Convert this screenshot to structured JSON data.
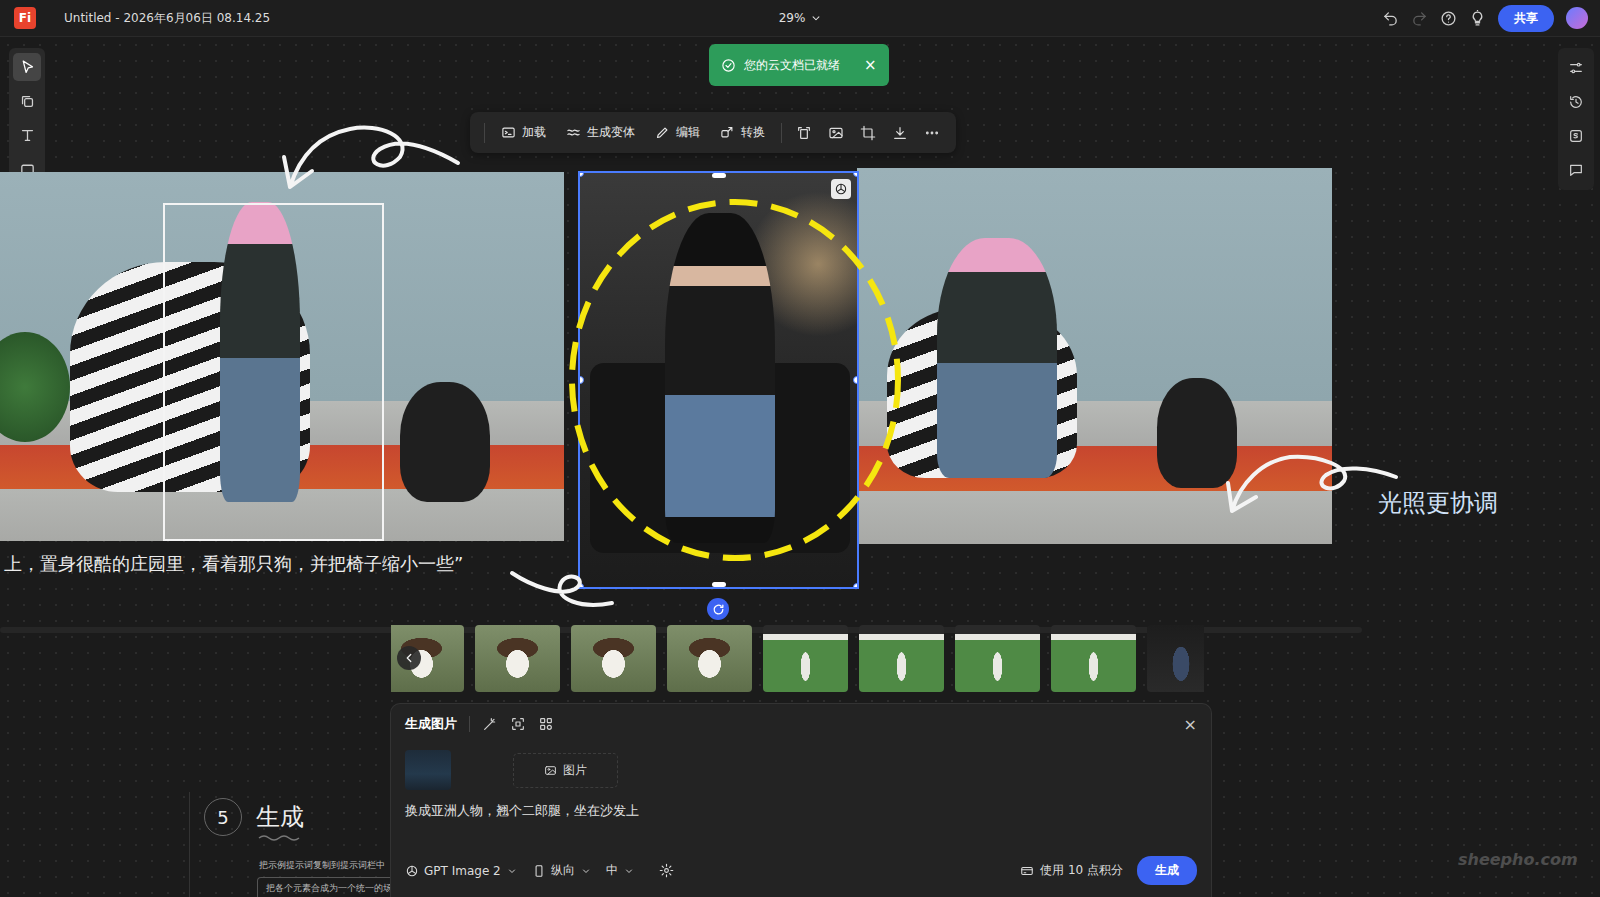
{
  "app": {
    "logo": "Fi",
    "title": "Untitled - 2026年6月06日 08.14.25",
    "zoom": "29%",
    "share": "共享"
  },
  "toast": {
    "text": "您的云文档已就绪",
    "close": "×"
  },
  "left_toolbar": {
    "tools": [
      {
        "selected": true
      },
      {
        "selected": false
      },
      {
        "selected": false
      },
      {
        "selected": false
      },
      {
        "selected": false
      },
      {
        "selected": false
      }
    ]
  },
  "context_toolbar": {
    "actions": [
      "加载",
      "生成变体",
      "编辑",
      "转换"
    ]
  },
  "canvas": {
    "caption": "上，置身很酷的庄园里，看着那只狗，并把椅子缩小一些”",
    "annotation": "光照更协调",
    "images": [
      {
        "selected": false
      },
      {
        "selected": true
      },
      {
        "selected": false
      }
    ]
  },
  "thumbnails": [
    {
      "kind": "cow"
    },
    {
      "kind": "cow"
    },
    {
      "kind": "cow"
    },
    {
      "kind": "cow"
    },
    {
      "kind": "garden"
    },
    {
      "kind": "garden"
    },
    {
      "kind": "garden"
    },
    {
      "kind": "garden"
    },
    {
      "kind": "person"
    }
  ],
  "panel": {
    "title": "生成图片",
    "close": "×",
    "reference_label": "图片",
    "prompt": "换成亚洲人物，翘个二郎腿，坐在沙发上",
    "model": "GPT Image 2",
    "orientation": "纵向",
    "size": "中",
    "credits": "使用 10 点积分",
    "generate": "生成"
  },
  "step": {
    "number": "5",
    "title": "生成",
    "hint": "把示例提示词复制到提示词栏中",
    "example": "把各个元素合成为一个统一的场景"
  },
  "watermark": "sheepho.com"
}
